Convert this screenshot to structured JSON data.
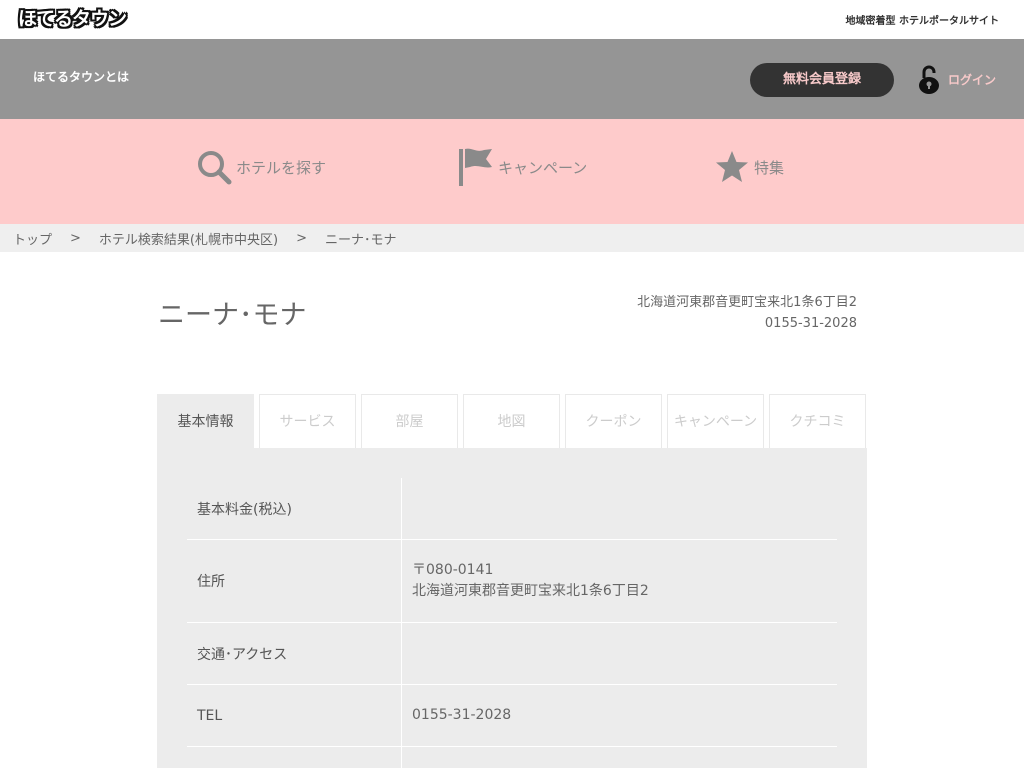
{
  "site": {
    "logo_text": "ほてるタウン",
    "tagline": "地域密着型 ホテルポータルサイト"
  },
  "header": {
    "about_label": "ほてるタウンとは",
    "register_label": "無料会員登録",
    "login_label": "ログイン"
  },
  "nav": {
    "items": [
      {
        "label": "ホテルを探す",
        "icon": "search-icon"
      },
      {
        "label": "キャンペーン",
        "icon": "flag-icon"
      },
      {
        "label": "特集",
        "icon": "star-icon"
      }
    ]
  },
  "breadcrumb": {
    "items": [
      "トップ",
      "ホテル検索結果(札幌市中央区)",
      "ニーナ･モナ"
    ],
    "separator": ">"
  },
  "hotel": {
    "name": "ニーナ･モナ",
    "address": "北海道河東郡音更町宝来北1条6丁目2",
    "phone": "0155-31-2028"
  },
  "tabs": [
    {
      "label": "基本情報",
      "active": true
    },
    {
      "label": "サービス",
      "active": false
    },
    {
      "label": "部屋",
      "active": false
    },
    {
      "label": "地図",
      "active": false
    },
    {
      "label": "クーポン",
      "active": false
    },
    {
      "label": "キャンペーン",
      "active": false
    },
    {
      "label": "クチコミ",
      "active": false
    }
  ],
  "info": {
    "rows": [
      {
        "key": "基本料金(税込)",
        "lines": []
      },
      {
        "key": "住所",
        "lines": [
          "〒080-0141",
          "北海道河東郡音更町宝来北1条6丁目2"
        ]
      },
      {
        "key": "交通･アクセス",
        "lines": []
      },
      {
        "key": "TEL",
        "lines": [
          "0155-31-2028"
        ]
      }
    ]
  },
  "colors": {
    "header_gray": "#959595",
    "nav_pink": "#fecbcb",
    "accent_pink": "#f7c9c9",
    "panel_gray": "#ececec"
  }
}
